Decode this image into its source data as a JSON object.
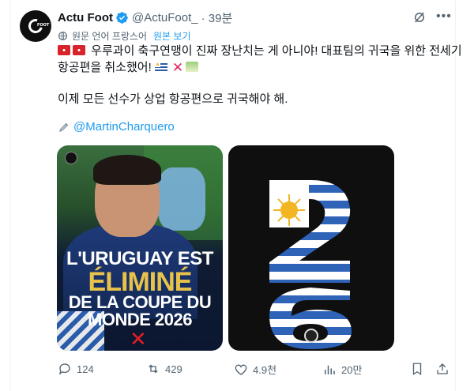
{
  "author": {
    "name": "Actu Foot",
    "handle": "@ActuFoot_",
    "time": "· 39분",
    "avatar_label": "FOOT"
  },
  "translation": {
    "label": "원문 언어 프랑스어",
    "show_original": "원본 보기"
  },
  "tweet": {
    "line1": "우루과이 축구연맹이 진짜 장난치는 게 아니야! 대표팀의 귀국을 위한 전세기",
    "line2": "항공편을 취소했어!",
    "line3": "이제 모든 선수가 상업 항공편으로 귀국해야 해.",
    "mention": "@MartinCharquero"
  },
  "media_left": {
    "headline_1": "L'URUGUAY EST",
    "headline_2": "ÉLIMINÉ",
    "headline_3": "DE LA COUPE DU",
    "headline_4": "MONDE 2026",
    "mark": "✕"
  },
  "media_right": {
    "digits": "26"
  },
  "actions": {
    "replies": "124",
    "reposts": "429",
    "likes": "4.9천",
    "views": "20만"
  },
  "colors": {
    "accent": "#1d9bf0",
    "muted": "#536471",
    "text": "#0f1419",
    "uruguay_blue": "#2e63b8",
    "sun": "#f2b624",
    "gold": "#e8c24a",
    "red": "#e21f26"
  },
  "icons": {
    "verified": "verified-badge-icon",
    "grok": "grok-icon",
    "more": "more-icon",
    "translate": "globe-icon",
    "pencil": "pencil-icon",
    "reply": "reply-icon",
    "repost": "repost-icon",
    "like": "heart-icon",
    "views": "views-icon",
    "bookmark": "bookmark-icon",
    "share": "share-icon"
  }
}
